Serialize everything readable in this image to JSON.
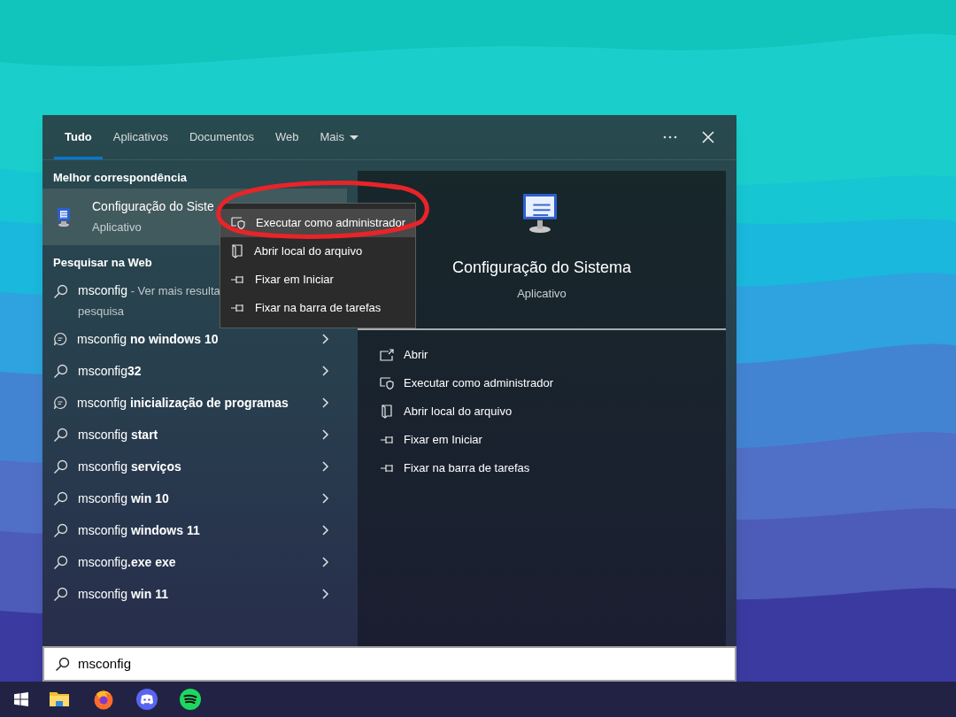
{
  "tabs": [
    {
      "label": "Tudo",
      "selected": true
    },
    {
      "label": "Aplicativos",
      "selected": false
    },
    {
      "label": "Documentos",
      "selected": false
    },
    {
      "label": "Web",
      "selected": false
    },
    {
      "label": "Mais",
      "selected": false
    }
  ],
  "best_match": {
    "heading": "Melhor correspondência",
    "title": "Configuração do Siste",
    "subtitle": "Aplicativo",
    "selected": true
  },
  "web": {
    "heading": "Pesquisar na Web",
    "see_more": {
      "query": "msconfig",
      "note": "- Ver mais resulta",
      "note_continued": "pesquisa"
    },
    "results": [
      {
        "kind": "bubble",
        "text": "msconfig **no windows 10**"
      },
      {
        "kind": "search",
        "text": "msconfig**32**"
      },
      {
        "kind": "bubble",
        "text": "msconfig **inicialização de programas**"
      },
      {
        "kind": "search",
        "text": "msconfig **start**"
      },
      {
        "kind": "search",
        "text": "msconfig **serviços**"
      },
      {
        "kind": "search",
        "text": "msconfig **win 10**"
      },
      {
        "kind": "search",
        "text": "msconfig **windows 11**"
      },
      {
        "kind": "search",
        "text": "msconfig**.exe exe**"
      },
      {
        "kind": "search",
        "text": "msconfig **win 11**"
      }
    ]
  },
  "context_menu": [
    {
      "kind": "admin",
      "label": "Executar como administrador",
      "selected": true
    },
    {
      "kind": "location",
      "label": "Abrir local do arquivo",
      "selected": false
    },
    {
      "kind": "pin",
      "label": "Fixar em Iniciar",
      "selected": false
    },
    {
      "kind": "pin",
      "label": "Fixar na barra de tarefas",
      "selected": false
    }
  ],
  "preview": {
    "title": "Configuração do Sistema",
    "subtitle": "Aplicativo",
    "actions": [
      {
        "kind": "open",
        "label": "Abrir"
      },
      {
        "kind": "admin",
        "label": "Executar como administrador"
      },
      {
        "kind": "location",
        "label": "Abrir local do arquivo"
      },
      {
        "kind": "pin",
        "label": "Fixar em Iniciar"
      },
      {
        "kind": "pin",
        "label": "Fixar na barra de tarefas"
      }
    ]
  },
  "search": {
    "value": "msconfig"
  }
}
